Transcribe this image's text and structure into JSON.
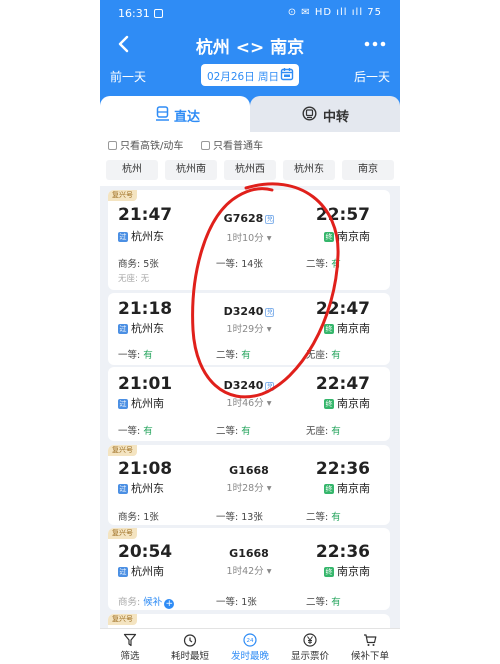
{
  "status": {
    "time": "16:31",
    "indicators": "⊙ ✉ HD ıll ıll 75"
  },
  "nav": {
    "title": "杭州 <> 南京"
  },
  "date_bar": {
    "prev": "前一天",
    "date": "02月26日 周日",
    "next": "后一天"
  },
  "tabs": [
    {
      "label": "直达",
      "active": true
    },
    {
      "label": "中转",
      "active": false
    }
  ],
  "filters": {
    "high_speed_only": "只看高铁/动车",
    "regular_only": "只看普通车"
  },
  "stations": [
    "杭州",
    "杭州南",
    "杭州西",
    "杭州东",
    "南京"
  ],
  "origin_tag": "过",
  "terminal_tag": "终",
  "train_tag": "兑",
  "trains": [
    {
      "badge": "复兴号",
      "dep_time": "21:47",
      "dep_station": "杭州东",
      "train_no": "G7628",
      "duration": "1时10分",
      "arr_time": "22:57",
      "arr_station": "南京南",
      "seats": [
        {
          "label": "商务:",
          "value": "5张"
        },
        {
          "label": "一等:",
          "value": "14张"
        },
        {
          "label": "二等:",
          "value": "有"
        }
      ],
      "extra": "无座: 无"
    },
    {
      "badge": "",
      "dep_time": "21:18",
      "dep_station": "杭州东",
      "train_no": "D3240",
      "duration": "1时29分",
      "arr_time": "22:47",
      "arr_station": "南京南",
      "seats": [
        {
          "label": "一等:",
          "value": "有"
        },
        {
          "label": "二等:",
          "value": "有"
        },
        {
          "label": "无座:",
          "value": "有"
        }
      ]
    },
    {
      "badge": "",
      "dep_time": "21:01",
      "dep_station": "杭州南",
      "train_no": "D3240",
      "duration": "1时46分",
      "arr_time": "22:47",
      "arr_station": "南京南",
      "seats": [
        {
          "label": "一等:",
          "value": "有"
        },
        {
          "label": "二等:",
          "value": "有"
        },
        {
          "label": "无座:",
          "value": "有"
        }
      ]
    },
    {
      "badge": "复兴号",
      "dep_time": "21:08",
      "dep_station": "杭州东",
      "train_no": "G1668",
      "duration": "1时28分",
      "arr_time": "22:36",
      "arr_station": "南京南",
      "seats": [
        {
          "label": "商务:",
          "value": "1张"
        },
        {
          "label": "一等:",
          "value": "13张"
        },
        {
          "label": "二等:",
          "value": "有"
        }
      ]
    },
    {
      "badge": "复兴号",
      "dep_time": "20:54",
      "dep_station": "杭州南",
      "train_no": "G1668",
      "duration": "1时42分",
      "arr_time": "22:36",
      "arr_station": "南京南",
      "seats": [
        {
          "label": "商务:",
          "value": "候补"
        },
        {
          "label": "一等:",
          "value": "1张"
        },
        {
          "label": "二等:",
          "value": "有"
        }
      ]
    }
  ],
  "bottom_nav": [
    {
      "label": "筛选",
      "icon": "filter-icon"
    },
    {
      "label": "耗时最短",
      "icon": "timer-icon"
    },
    {
      "label": "发时最晚",
      "icon": "clock-24-icon",
      "active": true
    },
    {
      "label": "显示票价",
      "icon": "yen-icon"
    },
    {
      "label": "候补下单",
      "icon": "cart-icon"
    }
  ],
  "colors": {
    "primary": "#2f8cf5",
    "available": "#28a55f",
    "badge_bg": "#f4e4c1",
    "annotation": "#e0201b"
  }
}
